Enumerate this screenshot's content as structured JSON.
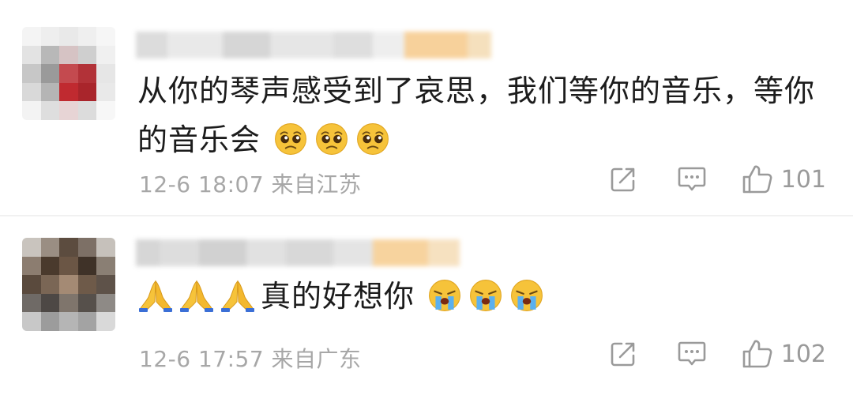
{
  "comments": [
    {
      "text_line1": "从你的琴声感受到了哀思，我们等你的音乐，等你",
      "text_line2": "的音乐会",
      "emoji_name": "pleading-face",
      "emoji_count": 3,
      "timestamp": "12-6 18:07",
      "location": "来自江苏",
      "likes": "101"
    },
    {
      "text": "真的好想你",
      "prefix_emoji": "folded-hands",
      "suffix_emoji": "loudly-crying-face",
      "timestamp": "12-6 17:57",
      "location": "来自广东",
      "likes": "102"
    }
  ],
  "colors": {
    "meta_text": "#a7a7a7",
    "icon": "#9a9a9a",
    "emoji_yellow": "#f6c33a"
  }
}
